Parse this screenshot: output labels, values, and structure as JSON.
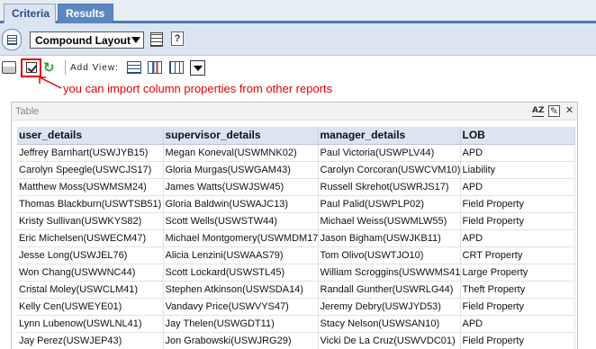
{
  "tabs": [
    {
      "label": "Criteria",
      "active": false
    },
    {
      "label": "Results",
      "active": true
    }
  ],
  "layout": {
    "selected": "Compound Layout",
    "props_icon": "properties-icon",
    "help_icon": "help-icon"
  },
  "toolbar": {
    "add_view_label": "Add View:",
    "icons": [
      "print-icon",
      "import-properties-icon",
      "refresh-icon",
      "table-view-icon",
      "chart-view-icon",
      "pivot-view-icon",
      "more-views-dropdown-icon"
    ]
  },
  "annotation": {
    "text": "you can import column properties from other reports",
    "color": "#e00000"
  },
  "table_view": {
    "title": "Table",
    "columns": [
      "user_details",
      "supervisor_details",
      "manager_details",
      "LOB"
    ],
    "rows": [
      [
        "Jeffrey Barnhart(USWJYB15)",
        "Megan Koneval(USWMNK02)",
        "Paul Victoria(USWPLV44)",
        "APD"
      ],
      [
        "Carolyn Speegle(USWCJS17)",
        "Gloria Murgas(USWGAM43)",
        "Carolyn Corcoran(USWCVM10)",
        "Liability"
      ],
      [
        "Matthew Moss(USWMSM24)",
        "James Watts(USWJSW45)",
        "Russell Skrehot(USWRJS17)",
        "APD"
      ],
      [
        "Thomas Blackburn(USWTSB51)",
        "Gloria Baldwin(USWAJC13)",
        "Paul Palid(USWPLP02)",
        "Field Property"
      ],
      [
        "Kristy Sullivan(USWKYS82)",
        "Scott Wells(USWSTW44)",
        "Michael Weiss(USWMLW55)",
        "Field Property"
      ],
      [
        "Eric Michelsen(USWECM47)",
        "Michael Montgomery(USWMDM17)",
        "Jason Bigham(USWJKB11)",
        "APD"
      ],
      [
        "Jesse Long(USWJEL76)",
        "Alicia Lenzini(USWAAS79)",
        "Tom Olivo(USWTJO10)",
        "CRT Property"
      ],
      [
        "Won Chang(USWWNC44)",
        "Scott Lockard(USWSTL45)",
        "William Scroggins(USWWMS41)",
        "Large Property"
      ],
      [
        "Cristal Moley(USWCLM41)",
        "Stephen Atkinson(USWSDA14)",
        "Randall Gunther(USWRLG44)",
        "Theft Property"
      ],
      [
        "Kelly Cen(USWEYE01)",
        "Vandavy Price(USWVYS47)",
        "Jeremy Debry(USWJYD53)",
        "Field Property"
      ],
      [
        "Lynn Lubenow(USWLNL41)",
        "Jay Thelen(USWGDT11)",
        "Stacy Nelson(USWSAN10)",
        "APD"
      ],
      [
        "Jay Perez(USWJEP43)",
        "Jon Grabowski(USWJRG29)",
        "Vicki De La Cruz(USWVDC01)",
        "Field Property"
      ]
    ]
  },
  "colors": {
    "tab_active": "#5b87bf",
    "header_band": "#dbe5f1",
    "table_header": "#dbe4f0",
    "highlight_red": "#e00000"
  }
}
